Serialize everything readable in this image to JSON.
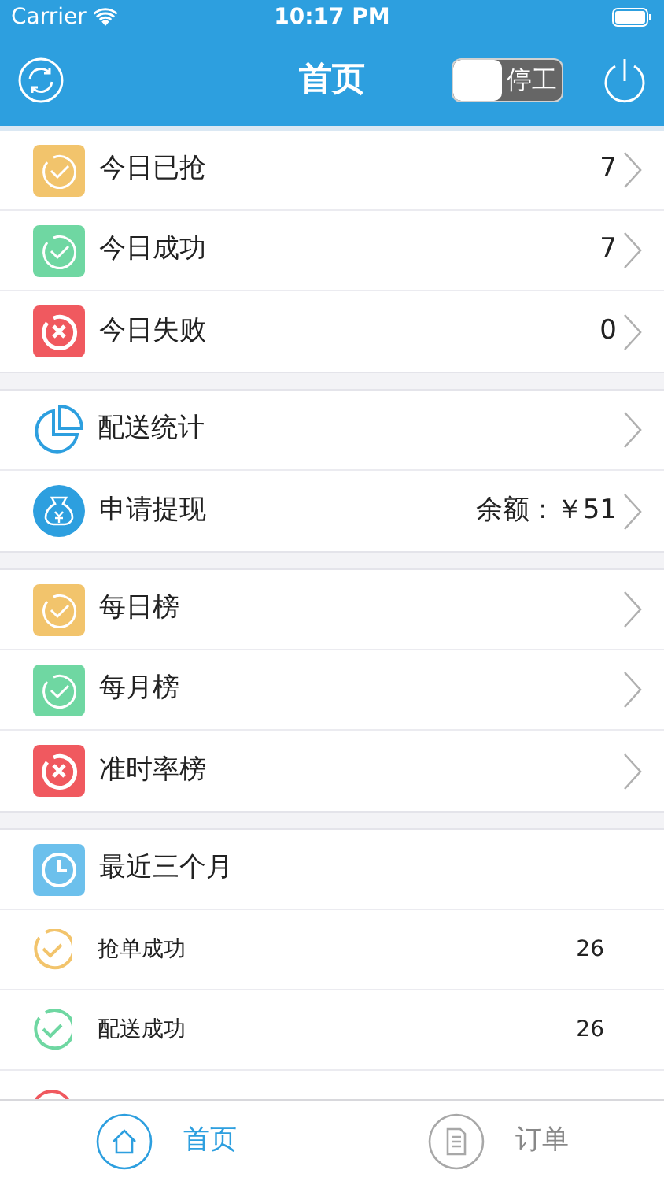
{
  "status_bar": {
    "carrier": "Carrier",
    "time": "10:17 PM"
  },
  "header": {
    "title": "首页",
    "switch": {
      "label": "停工",
      "on": false
    }
  },
  "groups": [
    {
      "rows": [
        {
          "kind": "check",
          "color": "#f2c46c",
          "label": "今日已抢",
          "value": "7"
        },
        {
          "kind": "check",
          "color": "#6fd7a2",
          "label": "今日成功",
          "value": "7"
        },
        {
          "kind": "cross",
          "color": "#f0595f",
          "label": "今日失败",
          "value": "0"
        }
      ]
    },
    {
      "rows": [
        {
          "kind": "pie",
          "label": "配送统计"
        },
        {
          "kind": "moneybag",
          "label": "申请提现",
          "value": "余额：￥51"
        }
      ]
    },
    {
      "rows": [
        {
          "kind": "check",
          "color": "#f2c46c",
          "label": "每日榜"
        },
        {
          "kind": "check",
          "color": "#6fd7a2",
          "label": "每月榜"
        },
        {
          "kind": "cross",
          "color": "#f0595f",
          "label": "准时率榜"
        }
      ]
    }
  ],
  "recent": {
    "label": "最近三个月",
    "items": [
      {
        "color": "#f2c46c",
        "label": "抢单成功",
        "value": "26"
      },
      {
        "color": "#6fd7a2",
        "label": "配送成功",
        "value": "26"
      },
      {
        "color": "#f0595f"
      }
    ]
  },
  "tab_bar": [
    {
      "kind": "home",
      "label": "首页",
      "selected": true
    },
    {
      "kind": "document",
      "label": "订单",
      "selected": false
    }
  ]
}
